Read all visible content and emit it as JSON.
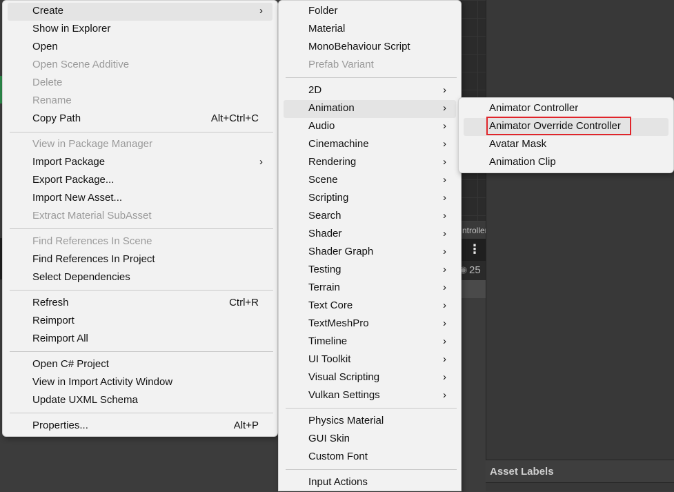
{
  "background": {
    "tab_label": "ntroller",
    "count": "25",
    "asset_labels": "Asset Labels"
  },
  "main_menu": [
    {
      "label": "Create",
      "submenu": true,
      "highlighted": true
    },
    {
      "label": "Show in Explorer"
    },
    {
      "label": "Open"
    },
    {
      "label": "Open Scene Additive",
      "disabled": true
    },
    {
      "label": "Delete",
      "disabled": true
    },
    {
      "label": "Rename",
      "disabled": true
    },
    {
      "label": "Copy Path",
      "shortcut": "Alt+Ctrl+C"
    },
    {
      "label": "View in Package Manager",
      "disabled": true
    },
    {
      "label": "Import Package",
      "submenu": true
    },
    {
      "label": "Export Package..."
    },
    {
      "label": "Import New Asset..."
    },
    {
      "label": "Extract Material SubAsset",
      "disabled": true
    },
    {
      "label": "Find References In Scene",
      "disabled": true
    },
    {
      "label": "Find References In Project"
    },
    {
      "label": "Select Dependencies"
    },
    {
      "label": "Refresh",
      "shortcut": "Ctrl+R"
    },
    {
      "label": "Reimport"
    },
    {
      "label": "Reimport All"
    },
    {
      "label": "Open C# Project"
    },
    {
      "label": "View in Import Activity Window"
    },
    {
      "label": "Update UXML Schema"
    },
    {
      "label": "Properties...",
      "shortcut": "Alt+P"
    }
  ],
  "create_menu": [
    {
      "label": "Folder"
    },
    {
      "label": "Material"
    },
    {
      "label": "MonoBehaviour Script"
    },
    {
      "label": "Prefab Variant",
      "disabled": true
    },
    {
      "label": "2D",
      "submenu": true
    },
    {
      "label": "Animation",
      "submenu": true,
      "highlighted": true
    },
    {
      "label": "Audio",
      "submenu": true
    },
    {
      "label": "Cinemachine",
      "submenu": true
    },
    {
      "label": "Rendering",
      "submenu": true
    },
    {
      "label": "Scene",
      "submenu": true
    },
    {
      "label": "Scripting",
      "submenu": true
    },
    {
      "label": "Search",
      "submenu": true
    },
    {
      "label": "Shader",
      "submenu": true
    },
    {
      "label": "Shader Graph",
      "submenu": true
    },
    {
      "label": "Testing",
      "submenu": true
    },
    {
      "label": "Terrain",
      "submenu": true
    },
    {
      "label": "Text Core",
      "submenu": true
    },
    {
      "label": "TextMeshPro",
      "submenu": true
    },
    {
      "label": "Timeline",
      "submenu": true
    },
    {
      "label": "UI Toolkit",
      "submenu": true
    },
    {
      "label": "Visual Scripting",
      "submenu": true
    },
    {
      "label": "Vulkan Settings",
      "submenu": true
    },
    {
      "label": "Physics Material"
    },
    {
      "label": "GUI Skin"
    },
    {
      "label": "Custom Font"
    },
    {
      "label": "Input Actions"
    }
  ],
  "animation_menu": [
    {
      "label": "Animator Controller"
    },
    {
      "label": "Animator Override Controller",
      "highlighted": true,
      "annotated": true
    },
    {
      "label": "Avatar Mask"
    },
    {
      "label": "Animation Clip"
    }
  ],
  "colors": {
    "menu_bg": "#f2f2f2",
    "highlight": "#e4e4e4",
    "annotation": "#e0242a",
    "disabled_text": "#9a9a9a"
  },
  "icons": {
    "submenu_arrow": "chevron-right-icon"
  }
}
